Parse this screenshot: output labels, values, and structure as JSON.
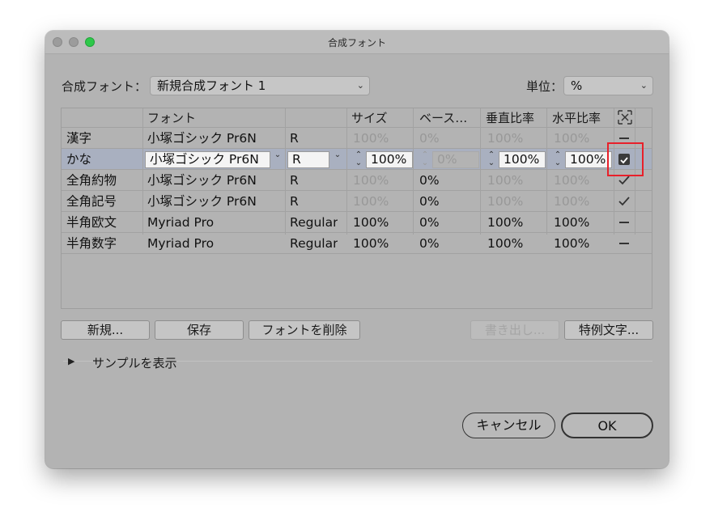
{
  "window": {
    "title": "合成フォント"
  },
  "composite_font": {
    "label": "合成フォント：",
    "value": "新規合成フォント 1"
  },
  "unit": {
    "label": "単位：",
    "value": "%"
  },
  "table": {
    "headers": [
      "フォント",
      "サイズ",
      "ベース…",
      "垂直比率",
      "水平比率"
    ],
    "rows": [
      {
        "type": "漢字",
        "font": "小塚ゴシック Pr6N",
        "style": "R",
        "size": "100%",
        "baseline": "0%",
        "vscale": "100%",
        "hscale": "100%",
        "dim": true,
        "mark": "dash"
      },
      {
        "type": "かな",
        "font": "小塚ゴシック Pr6N",
        "style": "R",
        "size": "100%",
        "baseline": "0%",
        "vscale": "100%",
        "hscale": "100%",
        "editing": true,
        "mark": "checkbox-checked"
      },
      {
        "type": "全角約物",
        "font": "小塚ゴシック Pr6N",
        "style": "R",
        "size": "100%",
        "baseline": "0%",
        "vscale": "100%",
        "hscale": "100%",
        "dim": true,
        "mark": "check"
      },
      {
        "type": "全角記号",
        "font": "小塚ゴシック Pr6N",
        "style": "R",
        "size": "100%",
        "baseline": "0%",
        "vscale": "100%",
        "hscale": "100%",
        "dim": true,
        "mark": "check"
      },
      {
        "type": "半角欧文",
        "font": "Myriad Pro",
        "style": "Regular",
        "size": "100%",
        "baseline": "0%",
        "vscale": "100%",
        "hscale": "100%",
        "mark": "dash"
      },
      {
        "type": "半角数字",
        "font": "Myriad Pro",
        "style": "Regular",
        "size": "100%",
        "baseline": "0%",
        "vscale": "100%",
        "hscale": "100%",
        "mark": "dash"
      }
    ]
  },
  "buttons": {
    "new": "新規...",
    "save": "保存",
    "delete": "フォントを削除",
    "export": "書き出し...",
    "exceptions": "特例文字...",
    "cancel": "キャンセル",
    "ok": "OK"
  },
  "sample": {
    "label": "サンプルを表示"
  },
  "colors": {
    "selected_row": "#a9b0c0",
    "highlight": "#e8202a",
    "traffic_green": "#2ec84a"
  }
}
